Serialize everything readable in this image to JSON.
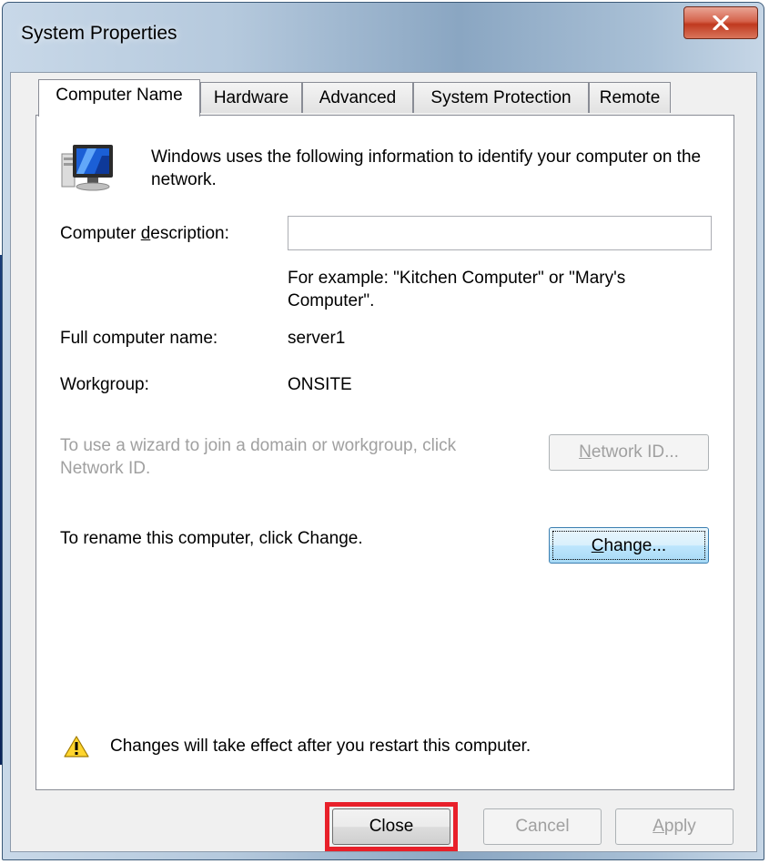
{
  "window": {
    "title": "System Properties"
  },
  "tabs": [
    {
      "label": "Computer Name",
      "active": true
    },
    {
      "label": "Hardware",
      "active": false
    },
    {
      "label": "Advanced",
      "active": false
    },
    {
      "label": "System Protection",
      "active": false
    },
    {
      "label": "Remote",
      "active": false
    }
  ],
  "computer_name_tab": {
    "intro": "Windows uses the following information to identify your computer on the network.",
    "description_label_pre": "Computer ",
    "description_label_accel": "d",
    "description_label_post": "escription:",
    "description_value": "",
    "description_example": "For example: \"Kitchen Computer\" or \"Mary's Computer\".",
    "full_name_label": "Full computer name:",
    "full_name_value": "server1",
    "workgroup_label": "Workgroup:",
    "workgroup_value": "ONSITE",
    "network_id_text": "To use a wizard to join a domain or workgroup, click Network ID.",
    "network_id_button_accel": "N",
    "network_id_button_rest": "etwork ID...",
    "rename_text": "To rename this computer, click Change.",
    "change_button_accel": "C",
    "change_button_rest": "hange...",
    "restart_notice": "Changes will take effect after you restart this computer."
  },
  "footer": {
    "close_label": "Close",
    "cancel_label": "Cancel",
    "apply_accel": "A",
    "apply_rest": "pply"
  },
  "colors": {
    "highlight_box": "#e8202a",
    "disabled_text": "#a0a0a0"
  }
}
